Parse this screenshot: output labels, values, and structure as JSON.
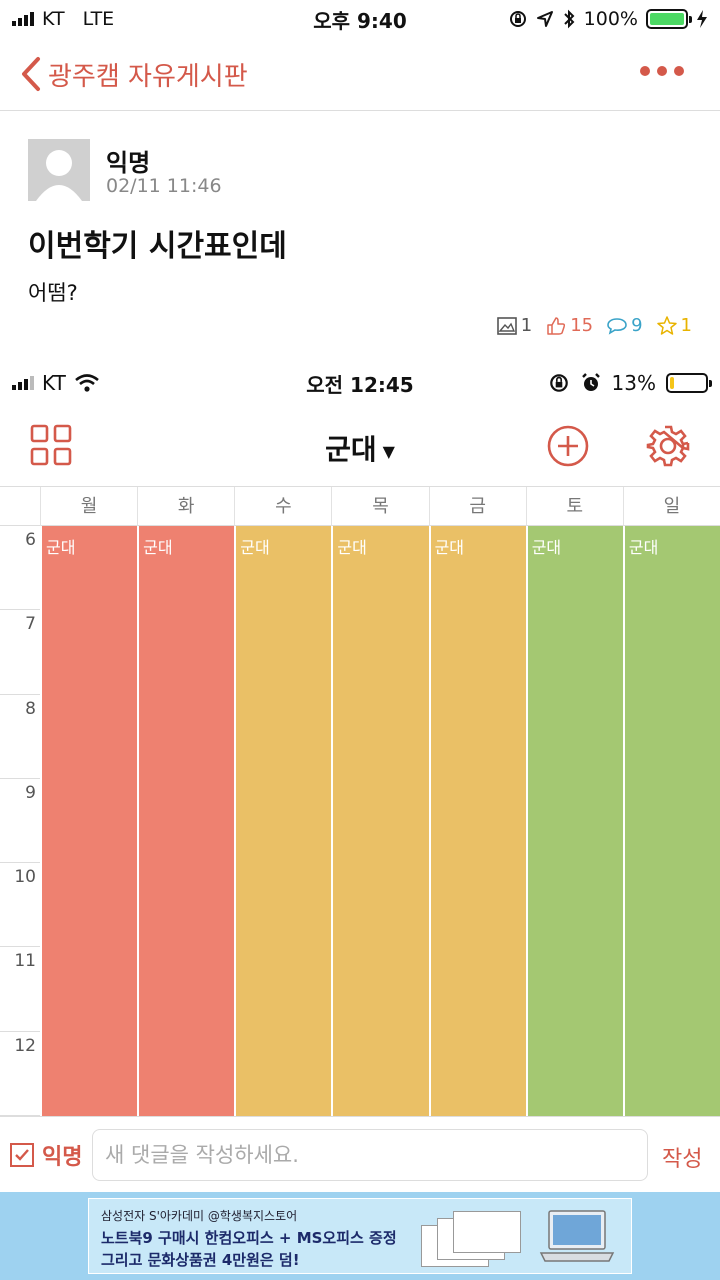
{
  "status": {
    "carrier": "KT",
    "network": "LTE",
    "time": "오후 9:40",
    "battery": "100%",
    "battery_level": 1.0,
    "battery_color": "#4cd964"
  },
  "nav": {
    "back_label": "광주캠 자유게시판",
    "more_icon": "more-dots-icon",
    "accent": "#d4594a"
  },
  "post": {
    "author": "익명",
    "date": "02/11 11:46",
    "title": "이번학기 시간표인데",
    "body": "어떰?",
    "images": "1",
    "likes": "15",
    "comments": "9",
    "scraps": "1"
  },
  "embedded": {
    "status": {
      "carrier": "KT",
      "time": "오전 12:45",
      "battery": "13%",
      "battery_level": 0.13,
      "battery_color": "#f5c518"
    },
    "title": "군대",
    "days": [
      "월",
      "화",
      "수",
      "목",
      "금",
      "토",
      "일"
    ],
    "hours": [
      "6",
      "7",
      "8",
      "9",
      "10",
      "11",
      "12"
    ],
    "event_label": "군대",
    "column_colors": [
      "#ee8170",
      "#ee8170",
      "#eac066",
      "#eac066",
      "#eac066",
      "#a4c872",
      "#a4c872"
    ]
  },
  "comment": {
    "anon_label": "익명",
    "placeholder": "새 댓글을 작성하세요.",
    "submit": "작성"
  },
  "ad": {
    "line1": "삼성전자 S'아카데미 @학생복지스토어",
    "line2": "노트북9 구매시 한컴오피스 + MS오피스 증정",
    "line3": "그리고 문화상품권 4만원은 덤!"
  }
}
